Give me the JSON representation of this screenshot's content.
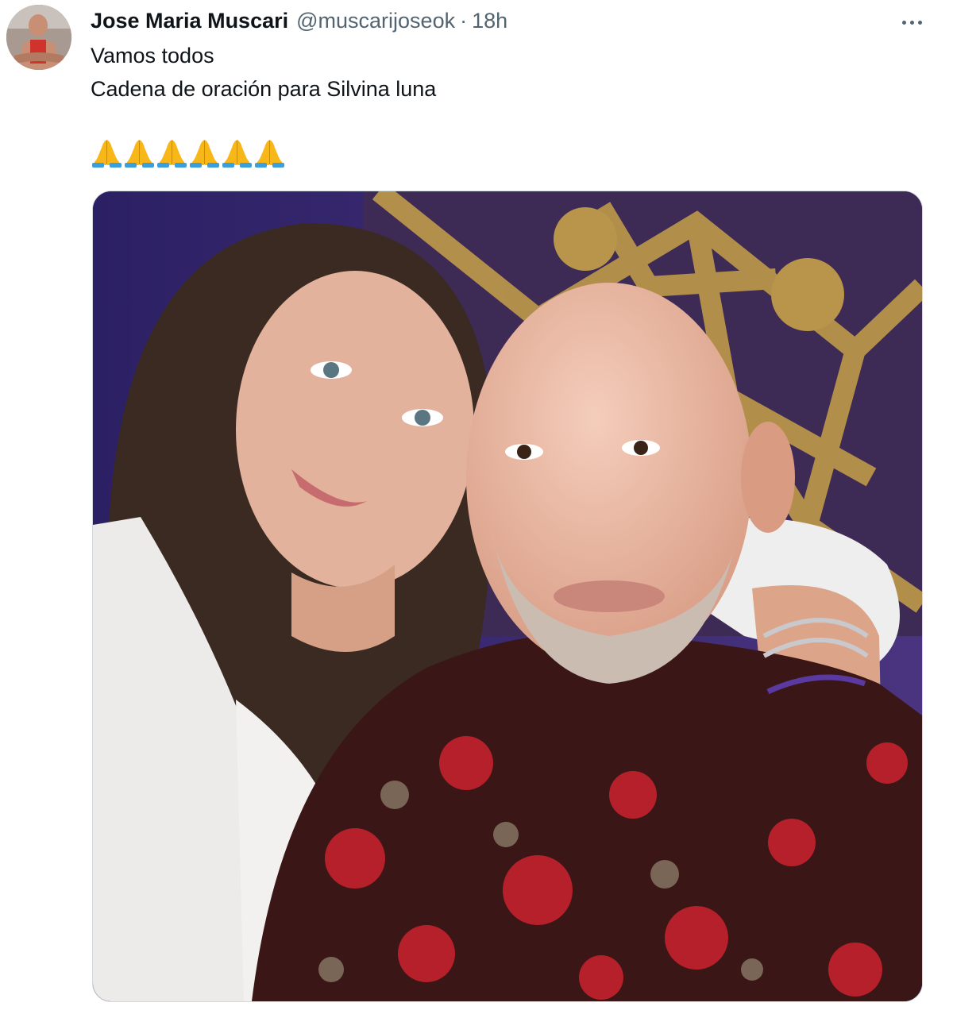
{
  "tweet": {
    "author": {
      "display_name": "Jose Maria Muscari",
      "handle": "@muscarijoseok",
      "separator": "·",
      "time": "18h",
      "avatar_icon": "user-avatar"
    },
    "text_lines": [
      "Vamos todos",
      "Cadena de oración para Silvina luna"
    ],
    "emoji": {
      "name": "folded-hands",
      "glyph": "🙏",
      "count": 6
    },
    "more_icon": "more-horizontal-icon",
    "media": {
      "type": "photo",
      "description_icon": "selfie-photo"
    }
  },
  "colors": {
    "text": "#0f1419",
    "secondary": "#536471",
    "border": "#cfd9de",
    "emoji_skin": "#f7b718",
    "emoji_sleeve": "#3a9fdc"
  }
}
